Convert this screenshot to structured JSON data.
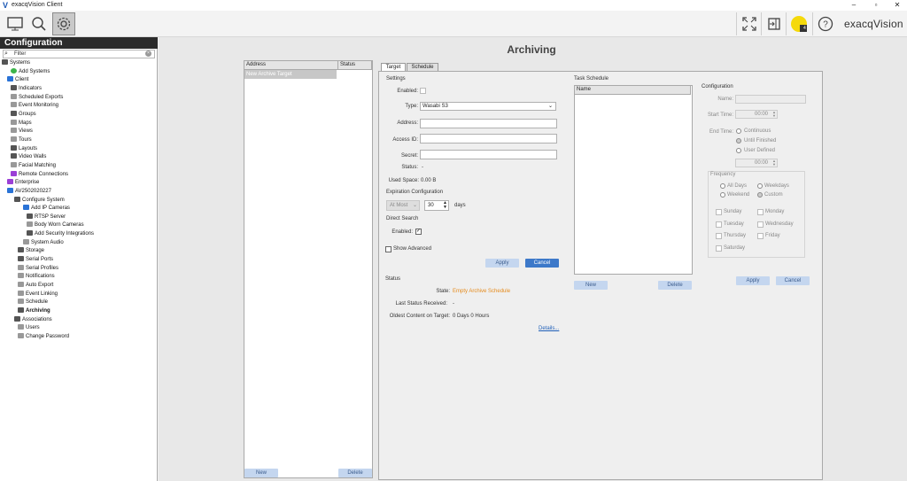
{
  "window": {
    "title": "exacqVision Client",
    "minimize": "–",
    "maximize": "▫",
    "close": "✕"
  },
  "brand": "exacqVision",
  "toolbar": {
    "notification_count": "4"
  },
  "sidebar": {
    "header": "Configuration",
    "filter_placeholder": "Filter",
    "items": [
      "Systems",
      "Add Systems",
      "Client",
      "Indicators",
      "Scheduled Exports",
      "Event Monitoring",
      "Groups",
      "Maps",
      "Views",
      "Tours",
      "Layouts",
      "Video Walls",
      "Facial Matching",
      "Remote Connections",
      "Enterprise",
      "AV2502020227",
      "Configure System",
      "Add IP Cameras",
      "RTSP Server",
      "Body Worn Cameras",
      "Add Security Integrations",
      "System Audio",
      "Storage",
      "Serial Ports",
      "Serial Profiles",
      "Notifications",
      "Auto Export",
      "Event Linking",
      "Schedule",
      "Archiving",
      "Associations",
      "Users",
      "Change Password"
    ]
  },
  "page": {
    "title": "Archiving"
  },
  "targets": {
    "col_address": "Address",
    "col_status": "Status",
    "rows": [
      "New Archive Target"
    ],
    "new": "New",
    "delete": "Delete"
  },
  "tabs": [
    "Target",
    "Schedule"
  ],
  "settings": {
    "title": "Settings",
    "enabled": "Enabled:",
    "type": "Type:",
    "type_value": "Wasabi S3",
    "address": "Address:",
    "access_id": "Access ID:",
    "secret": "Secret:",
    "status": "Status:",
    "status_value": "-",
    "used_space": "Used Space:",
    "used_space_value": "0.00 B"
  },
  "expiration": {
    "title": "Expiration Configuration",
    "mode": "At Most",
    "value": "30",
    "unit": "days"
  },
  "direct_search": {
    "title": "Direct Search",
    "enabled": "Enabled:"
  },
  "show_advanced": "Show Advanced",
  "buttons": {
    "apply": "Apply",
    "cancel": "Cancel"
  },
  "status_section": {
    "title": "Status",
    "state_label": "State:",
    "state_value": "Empty Archive Schedule",
    "last_label": "Last Status Received:",
    "last_value": "-",
    "oldest_label": "Oldest Content on Target:",
    "oldest_value": "0 Days 0 Hours",
    "details": "Details..."
  },
  "task_schedule": {
    "title": "Task Schedule",
    "col_name": "Name",
    "new": "New",
    "delete": "Delete"
  },
  "configuration": {
    "title": "Configuration",
    "name": "Name:",
    "start_time": "Start Time:",
    "start_value": "00:00",
    "end_time": "End Time:",
    "continuous": "Continuous",
    "until_finished": "Until Finished",
    "user_defined": "User Defined",
    "end_value": "00:00",
    "frequency": "Frequency",
    "all_days": "All Days",
    "weekdays": "Weekdays",
    "weekend": "Weekend",
    "custom": "Custom",
    "days": [
      "Sunday",
      "Monday",
      "Tuesday",
      "Wednesday",
      "Thursday",
      "Friday",
      "Saturday"
    ],
    "apply": "Apply",
    "cancel": "Cancel"
  },
  "colors": {
    "accent": "#3d79c9",
    "header": "#2b2b2b",
    "warning": "#e58a1b",
    "badge": "#f5d90a"
  }
}
